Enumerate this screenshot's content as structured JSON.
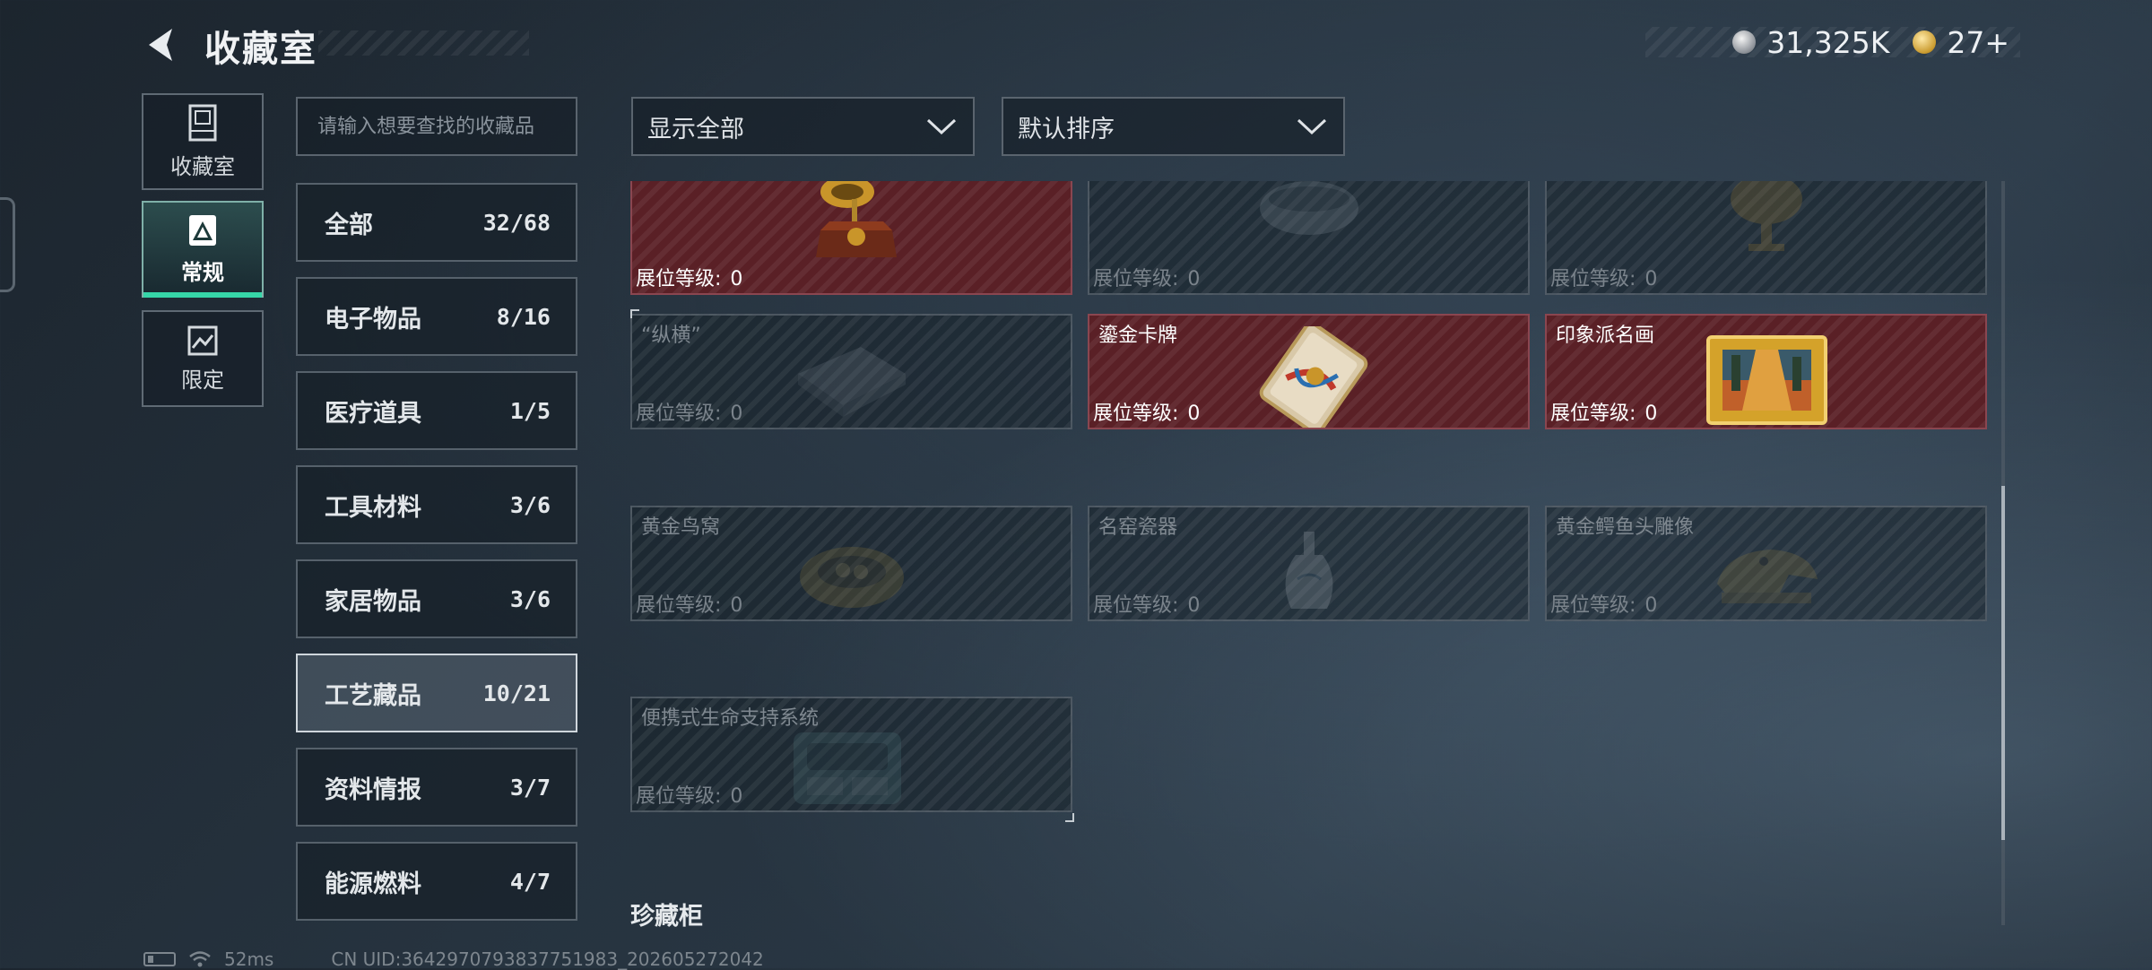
{
  "header": {
    "title": "收藏室",
    "currency_silver": "31,325K",
    "currency_gold": "27+"
  },
  "search": {
    "placeholder": "请输入想要查找的收藏品"
  },
  "side_nav": [
    {
      "label": "收藏室",
      "icon": "trophy-cabinet-icon",
      "active": false
    },
    {
      "label": "常规",
      "icon": "warning-triangle-doc-icon",
      "active": true
    },
    {
      "label": "限定",
      "icon": "limited-image-icon",
      "active": false
    }
  ],
  "categories": [
    {
      "name": "全部",
      "count": "32/68"
    },
    {
      "name": "电子物品",
      "count": "8/16"
    },
    {
      "name": "医疗道具",
      "count": "1/5"
    },
    {
      "name": "工具材料",
      "count": "3/6"
    },
    {
      "name": "家居物品",
      "count": "3/6"
    },
    {
      "name": "工艺藏品",
      "count": "10/21",
      "active": true
    },
    {
      "name": "资料情报",
      "count": "3/7"
    },
    {
      "name": "能源燃料",
      "count": "4/7"
    }
  ],
  "filters": {
    "show": "显示全部",
    "sort": "默认排序"
  },
  "items": [
    {
      "name": "",
      "level_label": "展位等级:",
      "level": "0",
      "owned": true,
      "icon": "gramophone-icon"
    },
    {
      "name": "",
      "level_label": "展位等级:",
      "level": "0",
      "owned": false,
      "icon": "ornate-bowl-icon"
    },
    {
      "name": "",
      "level_label": "展位等级:",
      "level": "0",
      "owned": false,
      "icon": "golden-cup-icon"
    },
    {
      "name": "“纵横”",
      "level_label": "展位等级:",
      "level": "0",
      "owned": false,
      "icon": "chess-box-icon"
    },
    {
      "name": "鎏金卡牌",
      "level_label": "展位等级:",
      "level": "0",
      "owned": true,
      "icon": "gilded-card-icon"
    },
    {
      "name": "印象派名画",
      "level_label": "展位等级:",
      "level": "0",
      "owned": true,
      "icon": "framed-painting-icon"
    },
    {
      "name": "黄金鸟窝",
      "level_label": "展位等级:",
      "level": "0",
      "owned": false,
      "icon": "golden-nest-icon"
    },
    {
      "name": "名窑瓷器",
      "level_label": "展位等级:",
      "level": "0",
      "owned": false,
      "icon": "porcelain-vase-icon"
    },
    {
      "name": "黄金鳄鱼头雕像",
      "level_label": "展位等级:",
      "level": "0",
      "owned": false,
      "icon": "crocodile-statue-icon"
    },
    {
      "name": "便携式生命支持系统",
      "level_label": "展位等级:",
      "level": "0",
      "owned": false,
      "icon": "life-support-device-icon"
    }
  ],
  "section_label": "珍藏柜",
  "status": {
    "ping": "52ms",
    "uid": "CN UID:3642970793837751983_202605272042"
  }
}
